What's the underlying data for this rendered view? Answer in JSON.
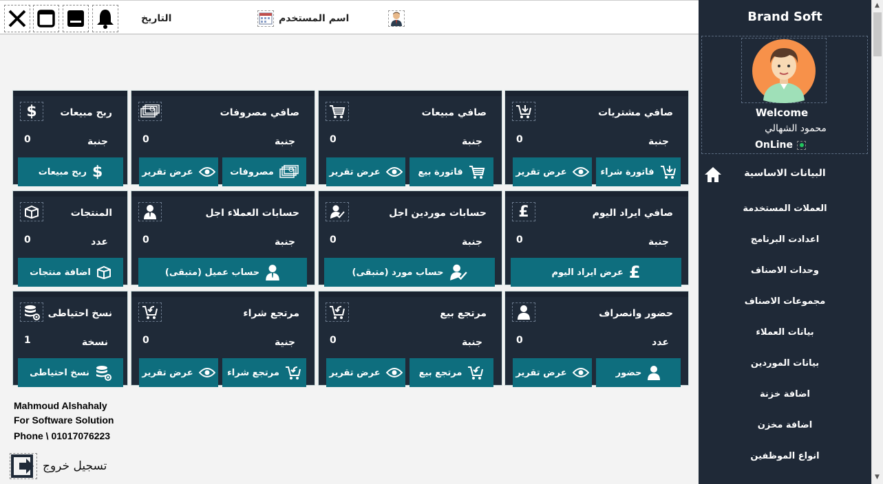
{
  "topbar": {
    "date_label": "التاريخ",
    "username_label": "اسم المستخدم"
  },
  "sidebar": {
    "brand": "Brand Soft",
    "welcome": "Welcome",
    "user_name": "محمود الشهالي",
    "status": "OnLine",
    "menu": [
      "البيانات الاساسية",
      "العملات المستخدمة",
      "اعدادت البرنامج",
      "وحدات الاصناف",
      "مجموعات الاصناف",
      "بيانات العملاء",
      "بيانات الموردين",
      "اضافة خزنة",
      "اضافة مخزن",
      "انواع الموظفين"
    ]
  },
  "cards": {
    "purchases": {
      "title": "صافي مشتريات",
      "value": "0",
      "unit": "جنبة",
      "btn1": "فاتورة شراء",
      "btn2": "عرض تقرير"
    },
    "sales": {
      "title": "صافي مبيعات",
      "value": "0",
      "unit": "جنبة",
      "btn1": "فاتورة بيع",
      "btn2": "عرض تقرير"
    },
    "expenses": {
      "title": "صافي مصروفات",
      "value": "0",
      "unit": "جنبة",
      "btn1": "مصروفات",
      "btn2": "عرض تقرير"
    },
    "profit": {
      "title": "ربح مبيعات",
      "value": "0",
      "unit": "جنبة",
      "btn1": "ربح مبيعات"
    },
    "income": {
      "title": "صافي ايراد اليوم",
      "value": "0",
      "unit": "جنبة",
      "btn1": "عرض ايراد اليوم"
    },
    "suppliers": {
      "title": "حسابات موردين اجل",
      "value": "0",
      "unit": "جنبة",
      "btn1": "حساب مورد (متبقى)"
    },
    "customers": {
      "title": "حسابات العملاء اجل",
      "value": "0",
      "unit": "جنبة",
      "btn1": "حساب عميل (متبقى)"
    },
    "products": {
      "title": "المنتجات",
      "value": "0",
      "unit": "عدد",
      "btn1": "اضافة منتجات"
    },
    "attendance": {
      "title": "حضور وانصراف",
      "value": "0",
      "unit": "عدد",
      "btn1": "حضور",
      "btn2": "عرض تقرير"
    },
    "sale_return": {
      "title": "مرتجع بيع",
      "value": "0",
      "unit": "جنبة",
      "btn1": "مرتجع بيع",
      "btn2": "عرض تقرير"
    },
    "purchase_return": {
      "title": "مرتجع شراء",
      "value": "0",
      "unit": "جنية",
      "btn1": "مرتجع شراء",
      "btn2": "عرض تقرير"
    },
    "backup": {
      "title": "نسخ احتياطى",
      "value": "1",
      "unit": "نسخة",
      "btn1": "نسخ احتياطى"
    }
  },
  "footer": {
    "line1": "Mahmoud Alshahaly",
    "line2": "For Software Solution",
    "line3": "Phone \\ 01017076223",
    "logout": "تسجيل خروج"
  },
  "colors": {
    "sidebar": "#1f2937",
    "card": "#1f2a38",
    "button": "#0e6e7e",
    "online": "#22c55e"
  }
}
